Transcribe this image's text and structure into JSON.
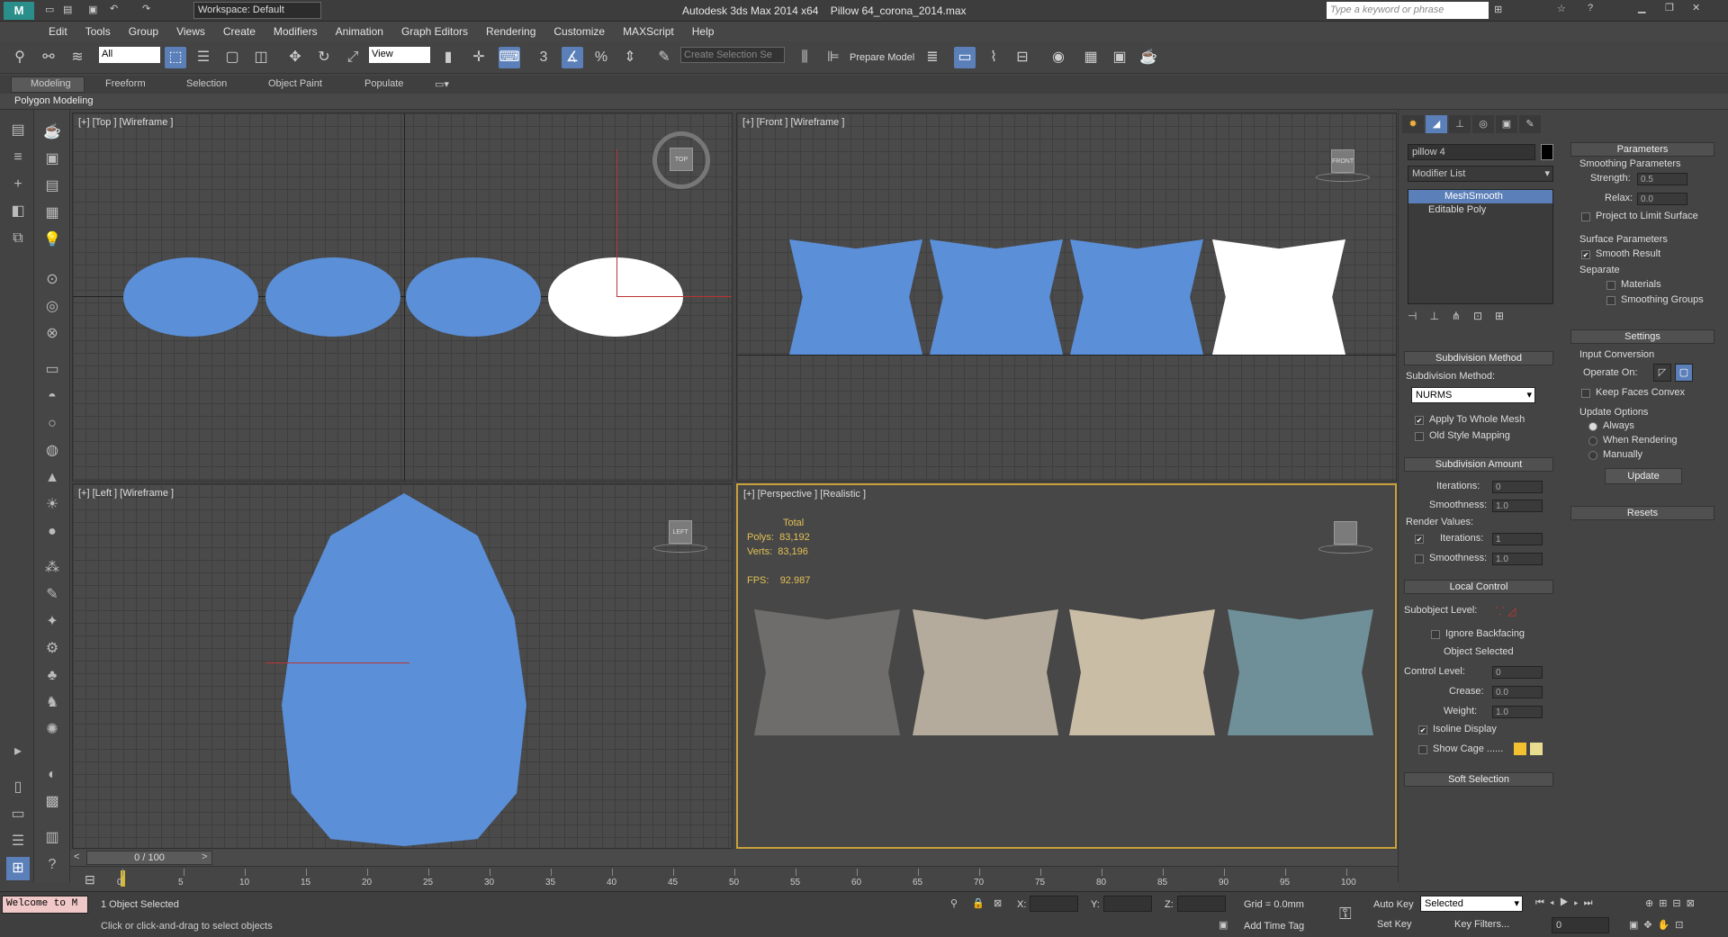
{
  "window": {
    "title": "Autodesk 3ds Max  2014 x64",
    "file": "Pillow 64_corona_2014.max",
    "workspace": "Workspace: Default",
    "search_placeholder": "Type a keyword or phrase"
  },
  "menu": [
    "Edit",
    "Tools",
    "Group",
    "Views",
    "Create",
    "Modifiers",
    "Animation",
    "Graph Editors",
    "Rendering",
    "Customize",
    "MAXScript",
    "Help"
  ],
  "toolbar": {
    "filter": "All",
    "view": "View",
    "selection_set": "Create Selection Se",
    "prepare_model": "Prepare Model"
  },
  "ribbon": {
    "tabs": [
      "Modeling",
      "Freeform",
      "Selection",
      "Object Paint",
      "Populate"
    ],
    "panel": "Polygon Modeling"
  },
  "viewports": {
    "top": "[+] [Top ] [Wireframe ]",
    "front": "[+] [Front ] [Wireframe ]",
    "left": "[+] [Left ] [Wireframe ]",
    "persp": "[+] [Perspective ] [Realistic ]"
  },
  "navcube": {
    "top": "TOP",
    "front": "FRONT",
    "left": "LEFT"
  },
  "stats": {
    "total": "Total",
    "polys_label": "Polys:",
    "polys": "83,192",
    "verts_label": "Verts:",
    "verts": "83,196",
    "fps_label": "FPS:",
    "fps": "92.987"
  },
  "cmdpanel": {
    "object_name": "pillow 4",
    "modifier_list": "Modifier List",
    "stack": [
      "MeshSmooth",
      "Editable Poly"
    ],
    "subdivision_method_title": "Subdivision Method",
    "subdivision_method_label": "Subdivision Method:",
    "subdivision_method_value": "NURMS",
    "apply_whole_mesh": "Apply To Whole Mesh",
    "old_style_mapping": "Old Style Mapping",
    "subdivision_amount_title": "Subdivision Amount",
    "iterations_label": "Iterations:",
    "iterations": "0",
    "smoothness_label": "Smoothness:",
    "smoothness": "1.0",
    "render_values": "Render Values:",
    "render_iterations": "1",
    "render_smoothness": "1.0",
    "local_control_title": "Local Control",
    "subobject_level": "Subobject Level:",
    "ignore_backfacing": "Ignore Backfacing",
    "object_selected": "Object Selected",
    "control_level_label": "Control Level:",
    "control_level": "0",
    "crease_label": "Crease:",
    "crease": "0.0",
    "weight_label": "Weight:",
    "weight": "1.0",
    "isoline_display": "Isoline Display",
    "show_cage": "Show Cage ......",
    "soft_selection": "Soft Selection"
  },
  "params": {
    "title": "Parameters",
    "smoothing_params": "Smoothing Parameters",
    "strength_label": "Strength:",
    "strength": "0.5",
    "relax_label": "Relax:",
    "relax": "0.0",
    "project_limit": "Project to Limit Surface",
    "surface_params": "Surface Parameters",
    "smooth_result": "Smooth Result",
    "separate": "Separate",
    "materials": "Materials",
    "smoothing_groups": "Smoothing Groups",
    "settings": "Settings",
    "input_conversion": "Input Conversion",
    "operate_on": "Operate On:",
    "keep_faces_convex": "Keep Faces Convex",
    "update_options": "Update Options",
    "always": "Always",
    "when_rendering": "When Rendering",
    "manually": "Manually",
    "update": "Update",
    "resets": "Resets"
  },
  "timeline": {
    "frame": "0 / 100",
    "ticks": [
      "0",
      "5",
      "10",
      "15",
      "20",
      "25",
      "30",
      "35",
      "40",
      "45",
      "50",
      "55",
      "60",
      "65",
      "70",
      "75",
      "80",
      "85",
      "90",
      "95",
      "100"
    ]
  },
  "status": {
    "maxscript": "Welcome to M",
    "selected": "1 Object Selected",
    "prompt": "Click or click-and-drag to select objects",
    "x": "X:",
    "y": "Y:",
    "z": "Z:",
    "grid": "Grid = 0.0mm",
    "add_time_tag": "Add Time Tag",
    "auto_key": "Auto Key",
    "set_key": "Set Key",
    "selected_mode": "Selected",
    "key_filters": "Key Filters...",
    "frame_value": "0"
  },
  "colors": {
    "wire_blue": "#5b8fd8",
    "accent": "#5b7fb8",
    "persp_border": "#c8a13a",
    "stats": "#e2c055"
  }
}
